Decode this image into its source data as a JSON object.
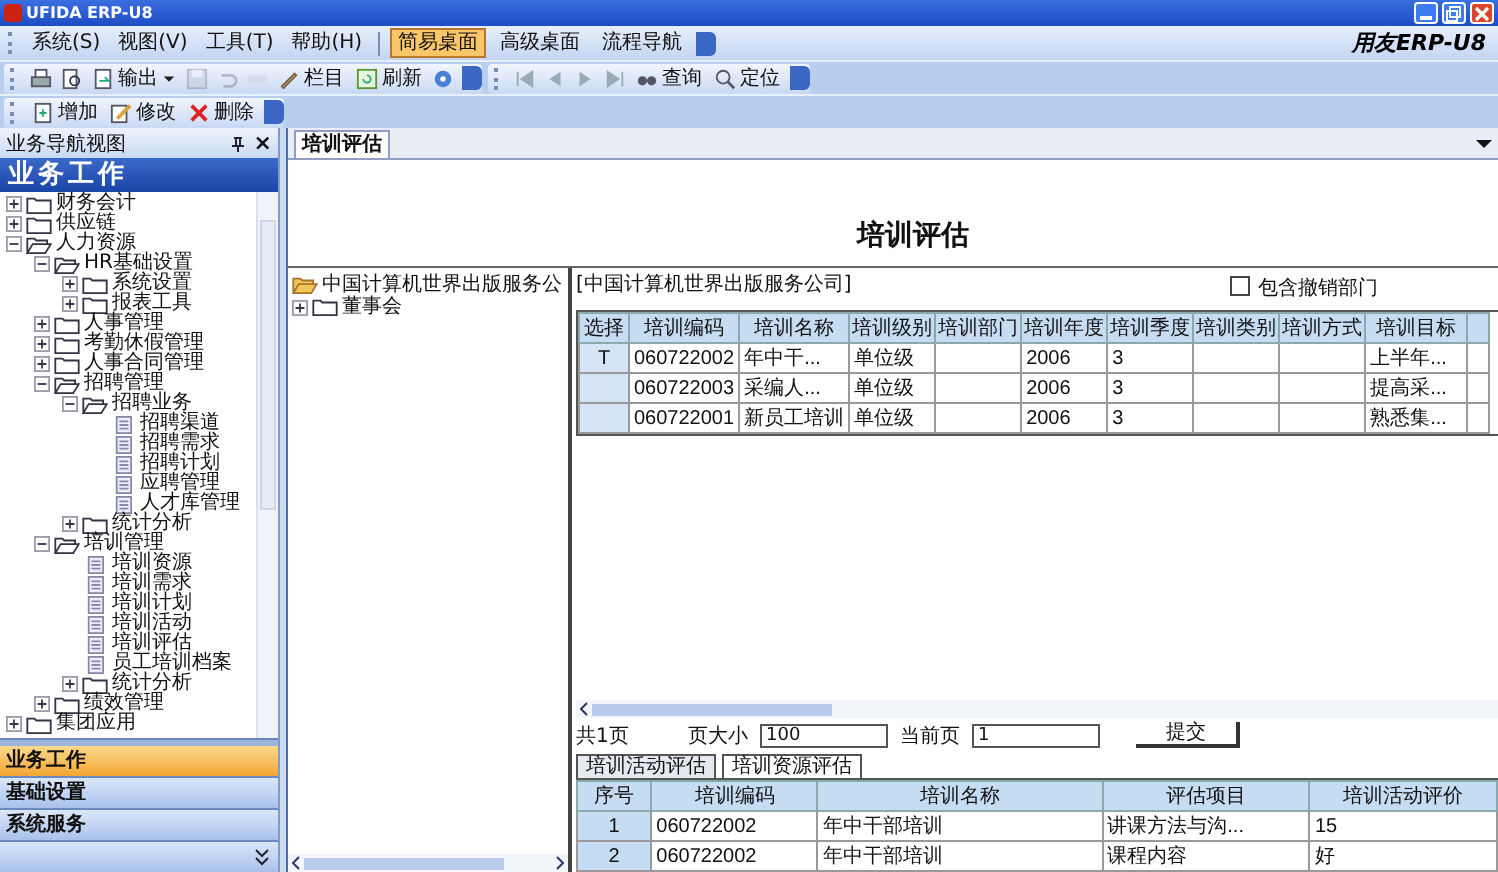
{
  "window": {
    "title": "UFIDA ERP-U8"
  },
  "menu": [
    "系统(S)",
    "视图(V)",
    "工具(T)",
    "帮助(H)"
  ],
  "desktop_tabs": [
    {
      "label": "简易桌面",
      "selected": true
    },
    {
      "label": "高级桌面",
      "selected": false
    },
    {
      "label": "流程导航",
      "selected": false
    }
  ],
  "brand": "用友ERP-U8",
  "toolbar": {
    "output": "输出",
    "columns": "栏目",
    "refresh": "刷新",
    "query": "查询",
    "locate": "定位"
  },
  "edit_bar": {
    "add": "增加",
    "edit": "修改",
    "delete": "删除"
  },
  "sidebar": {
    "title": "业务导航视图",
    "close": "×",
    "heading": "业务工作",
    "tree": [
      {
        "label": "财务会计",
        "kind": "folder",
        "expanded": false
      },
      {
        "label": "供应链",
        "kind": "folder",
        "expanded": false
      },
      {
        "label": "人力资源",
        "kind": "folder",
        "expanded": true,
        "children": [
          {
            "label": "HR基础设置",
            "kind": "folder",
            "expanded": true,
            "children": [
              {
                "label": "系统设置",
                "kind": "folder",
                "expanded": false
              },
              {
                "label": "报表工具",
                "kind": "folder",
                "expanded": false
              }
            ]
          },
          {
            "label": "人事管理",
            "kind": "folder",
            "expanded": false
          },
          {
            "label": "考勤休假管理",
            "kind": "folder",
            "expanded": false
          },
          {
            "label": "人事合同管理",
            "kind": "folder",
            "expanded": false
          },
          {
            "label": "招聘管理",
            "kind": "folder",
            "expanded": true,
            "children": [
              {
                "label": "招聘业务",
                "kind": "folder",
                "expanded": true,
                "children": [
                  {
                    "label": "招聘渠道",
                    "kind": "doc"
                  },
                  {
                    "label": "招聘需求",
                    "kind": "doc"
                  },
                  {
                    "label": "招聘计划",
                    "kind": "doc"
                  },
                  {
                    "label": "应聘管理",
                    "kind": "doc"
                  },
                  {
                    "label": "人才库管理",
                    "kind": "doc"
                  }
                ]
              },
              {
                "label": "统计分析",
                "kind": "folder",
                "expanded": false
              }
            ]
          },
          {
            "label": "培训管理",
            "kind": "folder",
            "expanded": true,
            "children": [
              {
                "label": "培训资源",
                "kind": "doc"
              },
              {
                "label": "培训需求",
                "kind": "doc"
              },
              {
                "label": "培训计划",
                "kind": "doc"
              },
              {
                "label": "培训活动",
                "kind": "doc"
              },
              {
                "label": "培训评估",
                "kind": "doc"
              },
              {
                "label": "员工培训档案",
                "kind": "doc"
              },
              {
                "label": "统计分析",
                "kind": "folder",
                "expanded": false
              }
            ]
          },
          {
            "label": "绩效管理",
            "kind": "folder",
            "expanded": false
          }
        ]
      },
      {
        "label": "集团应用",
        "kind": "folder",
        "expanded": false
      }
    ],
    "nav": [
      {
        "label": "业务工作",
        "selected": true
      },
      {
        "label": "基础设置",
        "selected": false
      },
      {
        "label": "系统服务",
        "selected": false
      }
    ]
  },
  "doc_tabs": [
    {
      "label": "培训评估",
      "selected": true
    }
  ],
  "page_title": "培训评估",
  "org_tree": [
    {
      "label": "中国计算机世界出版服务公",
      "kind": "root"
    },
    {
      "label": "董事会",
      "kind": "folder",
      "expanded": false
    }
  ],
  "org_label": "[中国计算机世界出版服务公司]",
  "include_revoked": {
    "label": "包含撤销部门",
    "checked": false
  },
  "grid": {
    "columns": [
      "选择",
      "培训编码",
      "培训名称",
      "培训级别",
      "培训部门",
      "培训年度",
      "培训季度",
      "培训类别",
      "培训方式",
      "培训目标"
    ],
    "rows": [
      [
        "T",
        "060722002",
        "年中干...",
        "单位级",
        null,
        "2006",
        "3",
        null,
        null,
        "上半年..."
      ],
      [
        null,
        "060722003",
        "采编人...",
        "单位级",
        null,
        "2006",
        "3",
        null,
        null,
        "提高采..."
      ],
      [
        null,
        "060722001",
        "新员工培训",
        "单位级",
        null,
        "2006",
        "3",
        null,
        null,
        "熟悉集..."
      ]
    ]
  },
  "pager": {
    "total": "共1页",
    "size_label": "页大小",
    "size": "100",
    "page_label": "当前页",
    "page": "1",
    "submit": "提交"
  },
  "sub_tabs": [
    {
      "label": "培训活动评估",
      "selected": true
    },
    {
      "label": "培训资源评估",
      "selected": false
    }
  ],
  "eval_grid": {
    "columns": [
      "序号",
      "培训编码",
      "培训名称",
      "评估项目",
      "培训活动评价"
    ],
    "rows": [
      [
        "1",
        "060722002",
        "年中干部培训",
        "讲课方法与沟...",
        "15"
      ],
      [
        "2",
        "060722002",
        "年中干部培训",
        "课程内容",
        "好"
      ]
    ]
  }
}
